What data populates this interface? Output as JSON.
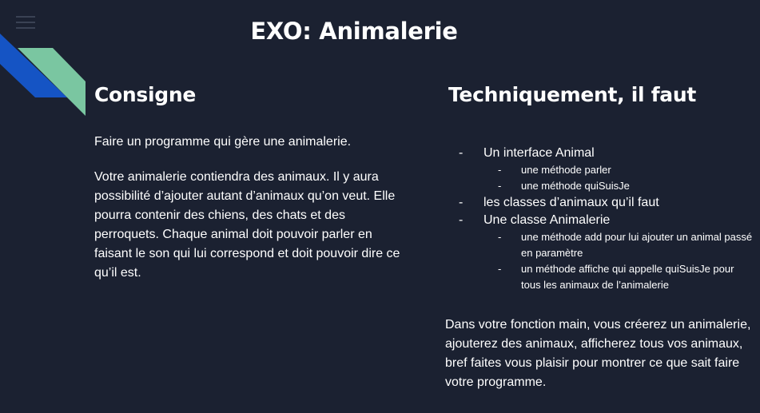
{
  "title": "EXO: Animalerie",
  "left": {
    "heading": "Consigne",
    "paragraph1": "Faire un programme qui gère une animalerie.",
    "paragraph2": "Votre animalerie contiendra des animaux. Il y aura possibilité d’ajouter autant d’animaux qu’on veut. Elle pourra contenir des chiens, des chats et des perroquets. Chaque animal doit pouvoir parler en faisant le son qui lui correspond et doit pouvoir dire ce qu’il est."
  },
  "right": {
    "heading": "Techniquement, il faut",
    "items": [
      {
        "label": "Un interface Animal",
        "subitems": [
          "une méthode parler",
          "une méthode quiSuisJe"
        ]
      },
      {
        "label": "les classes d’animaux qu’il faut",
        "subitems": []
      },
      {
        "label": "Une classe Animalerie",
        "subitems": [
          "une méthode add pour lui ajouter un animal passé en paramètre",
          "un méthode affiche qui appelle quiSuisJe pour tous les animaux de l’animalerie"
        ]
      }
    ],
    "paragraph": "Dans votre fonction main, vous créerez un animalerie, ajouterez des animaux, afficherez tous vos animaux, bref faites vous plaisir pour montrer ce que sait faire votre programme."
  },
  "colors": {
    "background": "#1b2131",
    "blue_stripe": "#1554c4",
    "green_stripe": "#7ac6a1",
    "text": "#ffffff"
  },
  "icons": {
    "menu": "hamburger-menu-icon"
  }
}
